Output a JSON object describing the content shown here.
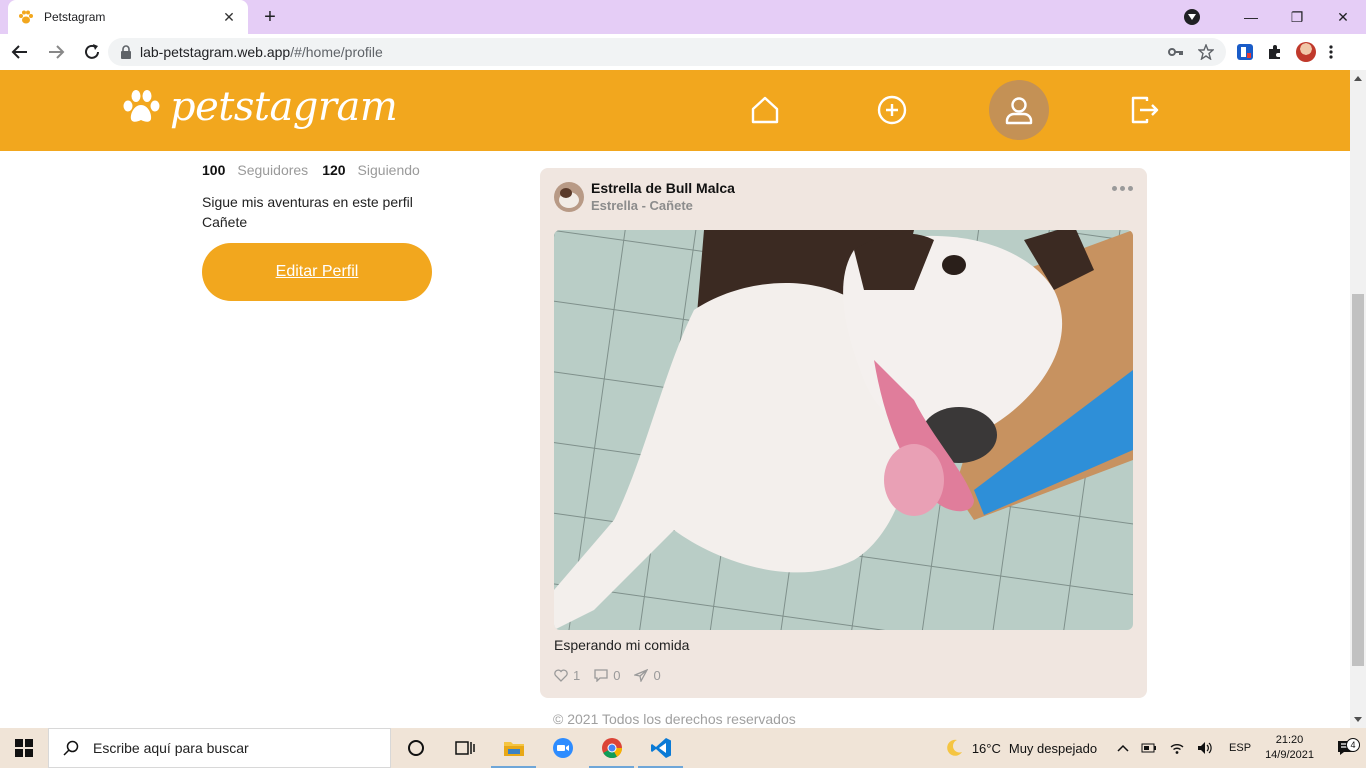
{
  "browser": {
    "tab_title": "Petstagram",
    "url_host": "lab-petstagram.web.app",
    "url_path": "/#/home/profile"
  },
  "app": {
    "brand": "petstagram",
    "accent_color": "#f2a71e",
    "nav": [
      {
        "icon": "home-icon"
      },
      {
        "icon": "add-circle-icon"
      },
      {
        "icon": "user-icon",
        "active": true
      },
      {
        "icon": "logout-icon"
      }
    ]
  },
  "profile": {
    "followers_count": "100",
    "followers_label": "Seguidores",
    "following_count": "120",
    "following_label": "Siguiendo",
    "bio_line1": "Sigue mis aventuras en este perfil",
    "bio_line2": "Cañete",
    "edit_button": "Editar Perfil"
  },
  "post": {
    "user_name": "Estrella de Bull Malca",
    "subtitle": "Estrella - Cañete",
    "caption": "Esperando mi comida",
    "likes": "1",
    "comments": "0",
    "shares": "0"
  },
  "footer": {
    "text": "© 2021 Todos los derechos reservados"
  },
  "taskbar": {
    "search_placeholder": "Escribe aquí para buscar",
    "temperature": "16°C",
    "weather": "Muy despejado",
    "language": "ESP",
    "time": "21:20",
    "date": "14/9/2021",
    "notification_count": "4"
  }
}
